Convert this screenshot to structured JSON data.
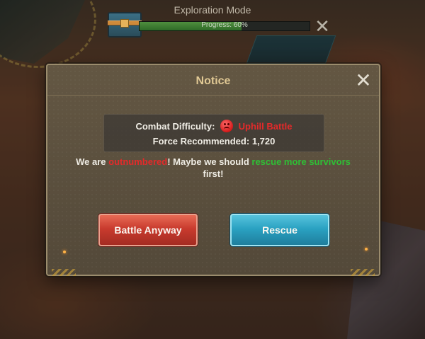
{
  "hud": {
    "title": "Exploration Mode",
    "progress_text": "Progress: 60%",
    "progress_value": 0.6,
    "close_icon": "close-x-icon",
    "chest_icon": "treasure-chest-icon"
  },
  "dialog": {
    "title": "Notice",
    "close_icon": "close-x-icon",
    "combat_difficulty_label": "Combat Difficulty:",
    "difficulty_icon": "sad-face-icon",
    "difficulty_value": "Uphill Battle",
    "force_label": "Force Recommended:",
    "force_value": "1,720",
    "message": {
      "part1": "We are ",
      "highlight_red": "outnumbered",
      "part2": "! Maybe we should ",
      "highlight_green": "rescue more survivors",
      "part3": " first!"
    },
    "buttons": {
      "battle_label": "Battle Anyway",
      "rescue_label": "Rescue"
    }
  },
  "colors": {
    "danger_red": "#e42a2a",
    "success_green": "#2fbf35",
    "title_gold": "#e0c894",
    "battle_button": "#c93b2e",
    "rescue_button": "#2aa2c2"
  }
}
